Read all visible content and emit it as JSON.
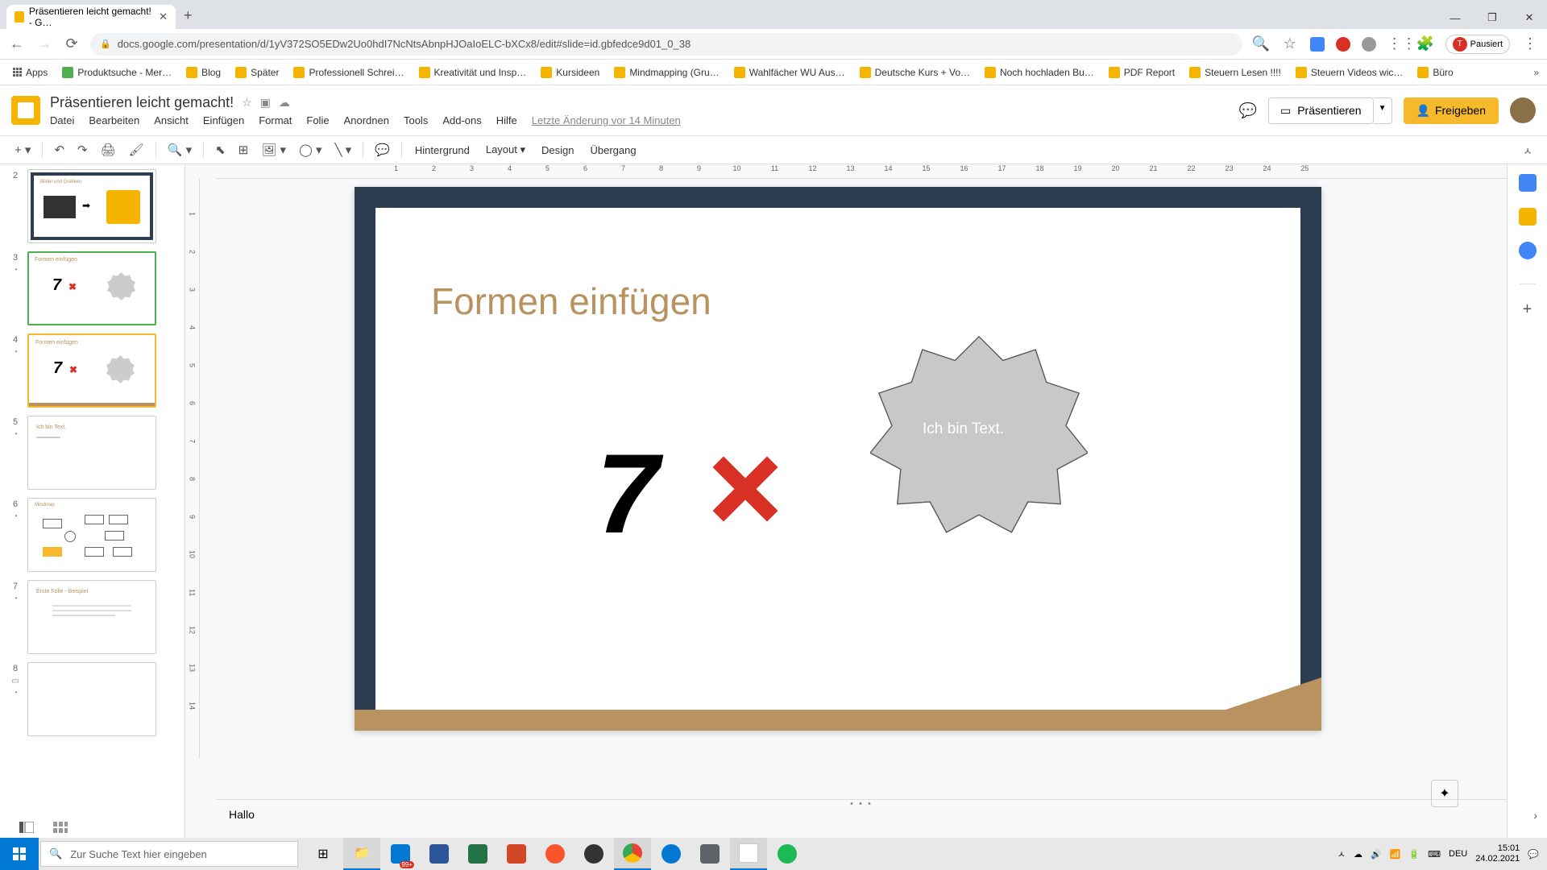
{
  "browser": {
    "tab_title": "Präsentieren leicht gemacht! - G…",
    "url": "docs.google.com/presentation/d/1yV372SO5EDw2Uo0hdI7NcNtsAbnpHJOaIoELC-bXCx8/edit#slide=id.gbfedce9d01_0_38",
    "pause_label": "Pausiert"
  },
  "bookmarks": {
    "apps": "Apps",
    "items": [
      "Produktsuche - Mer…",
      "Blog",
      "Später",
      "Professionell Schrei…",
      "Kreativität und Insp…",
      "Kursideen",
      "Mindmapping  (Gru…",
      "Wahlfächer WU Aus…",
      "Deutsche Kurs + Vo…",
      "Noch hochladen Bu…",
      "PDF Report",
      "Steuern Lesen !!!!",
      "Steuern Videos wic…",
      "Büro"
    ]
  },
  "app": {
    "doc_title": "Präsentieren leicht gemacht!",
    "menus": [
      "Datei",
      "Bearbeiten",
      "Ansicht",
      "Einfügen",
      "Format",
      "Folie",
      "Anordnen",
      "Tools",
      "Add-ons",
      "Hilfe"
    ],
    "last_edit": "Letzte Änderung vor 14 Minuten",
    "present": "Präsentieren",
    "share": "Freigeben"
  },
  "toolbar": {
    "background": "Hintergrund",
    "layout": "Layout",
    "design": "Design",
    "transition": "Übergang"
  },
  "ruler": {
    "h": [
      "1",
      "2",
      "3",
      "4",
      "5",
      "6",
      "7",
      "8",
      "9",
      "10",
      "11",
      "12",
      "13",
      "14",
      "15",
      "16",
      "17",
      "18",
      "19",
      "20",
      "21",
      "22",
      "23",
      "24",
      "25"
    ],
    "v": [
      "1",
      "2",
      "3",
      "4",
      "5",
      "6",
      "7",
      "8",
      "9",
      "10",
      "11",
      "12",
      "13",
      "14"
    ]
  },
  "thumbnails": [
    {
      "num": "2",
      "type": "image"
    },
    {
      "num": "3",
      "type": "formen",
      "anim": true
    },
    {
      "num": "4",
      "type": "formen",
      "selected": true
    },
    {
      "num": "5",
      "type": "text"
    },
    {
      "num": "6",
      "type": "mindmap"
    },
    {
      "num": "7",
      "type": "example"
    },
    {
      "num": "8",
      "type": "blank"
    }
  ],
  "thumb_labels": {
    "formen_title": "Formen einfügen",
    "formen_num": "7",
    "text_title": "Ich bin Text.",
    "mindmap_title": "Mindmap",
    "example_title": "Erste Folie - Beispiel",
    "images_title": "Bilder und Grafiken"
  },
  "slide": {
    "title": "Formen einfügen",
    "big_number": "7",
    "star_text": "Ich bin Text."
  },
  "speaker": {
    "notes": "Hallo"
  },
  "taskbar": {
    "search_placeholder": "Zur Suche Text hier eingeben",
    "lang": "DEU",
    "time": "15:01",
    "date": "24.02.2021",
    "notif": "99+"
  }
}
